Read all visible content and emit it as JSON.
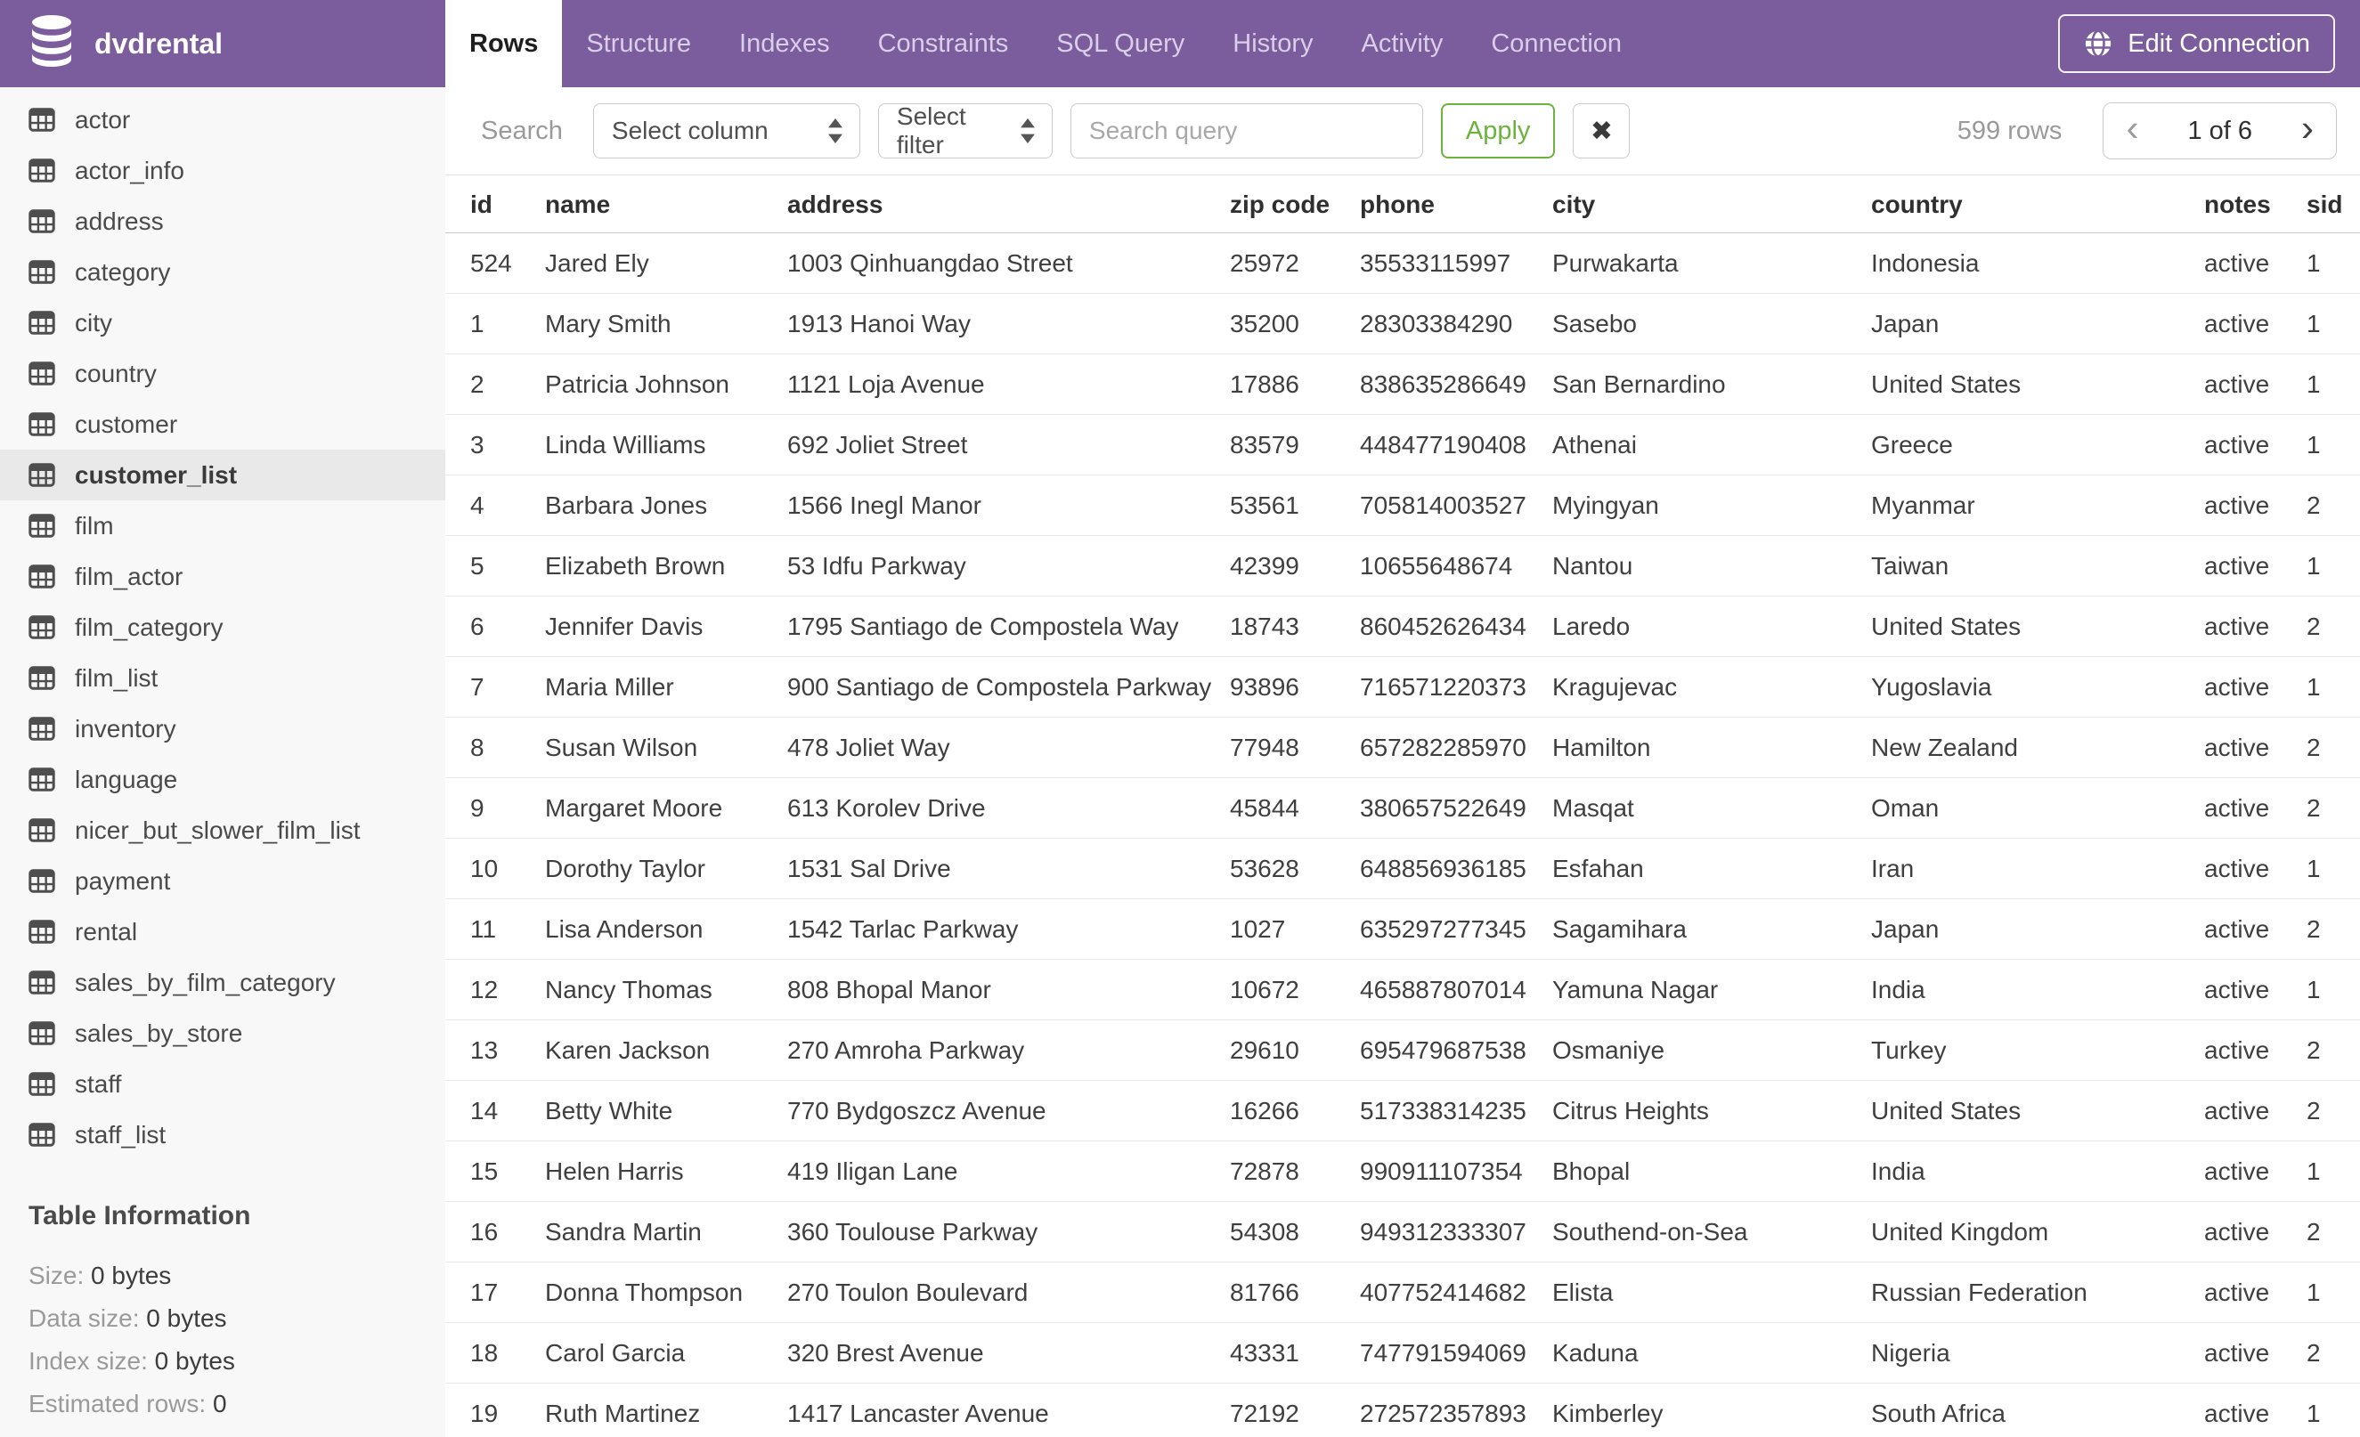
{
  "colors": {
    "header_purple": "#7b5d9d",
    "apply_green": "#6cb33e",
    "sidebar_selected": "#e9e9e9",
    "tab_inactive_text": "#d9cfe7"
  },
  "app": {
    "title": "dvdrental",
    "edit_connection_label": "Edit Connection"
  },
  "tabs": [
    {
      "label": "Rows",
      "active": true
    },
    {
      "label": "Structure",
      "active": false
    },
    {
      "label": "Indexes",
      "active": false
    },
    {
      "label": "Constraints",
      "active": false
    },
    {
      "label": "SQL Query",
      "active": false
    },
    {
      "label": "History",
      "active": false
    },
    {
      "label": "Activity",
      "active": false
    },
    {
      "label": "Connection",
      "active": false
    }
  ],
  "sidebar": {
    "tables": [
      "actor",
      "actor_info",
      "address",
      "category",
      "city",
      "country",
      "customer",
      "customer_list",
      "film",
      "film_actor",
      "film_category",
      "film_list",
      "inventory",
      "language",
      "nicer_but_slower_film_list",
      "payment",
      "rental",
      "sales_by_film_category",
      "sales_by_store",
      "staff",
      "staff_list"
    ],
    "selected": "customer_list",
    "info": {
      "heading": "Table Information",
      "rows": [
        {
          "label": "Size:",
          "value": "0 bytes"
        },
        {
          "label": "Data size:",
          "value": "0 bytes"
        },
        {
          "label": "Index size:",
          "value": "0 bytes"
        },
        {
          "label": "Estimated rows:",
          "value": "0"
        }
      ]
    }
  },
  "toolbar": {
    "search_label": "Search",
    "column_select_label": "Select column",
    "filter_select_label": "Select filter",
    "query_placeholder": "Search query",
    "apply_label": "Apply",
    "clear_label": "✖",
    "rows_count": "599 rows",
    "pagination": {
      "prev_label": "‹",
      "page_label": "1 of 6",
      "next_label": "›"
    }
  },
  "table": {
    "columns": [
      "id",
      "name",
      "address",
      "zip code",
      "phone",
      "city",
      "country",
      "notes",
      "sid"
    ],
    "rows": [
      [
        "524",
        "Jared Ely",
        "1003 Qinhuangdao Street",
        "25972",
        "35533115997",
        "Purwakarta",
        "Indonesia",
        "active",
        "1"
      ],
      [
        "1",
        "Mary Smith",
        "1913 Hanoi Way",
        "35200",
        "28303384290",
        "Sasebo",
        "Japan",
        "active",
        "1"
      ],
      [
        "2",
        "Patricia Johnson",
        "1121 Loja Avenue",
        "17886",
        "838635286649",
        "San Bernardino",
        "United States",
        "active",
        "1"
      ],
      [
        "3",
        "Linda Williams",
        "692 Joliet Street",
        "83579",
        "448477190408",
        "Athenai",
        "Greece",
        "active",
        "1"
      ],
      [
        "4",
        "Barbara Jones",
        "1566 Inegl Manor",
        "53561",
        "705814003527",
        "Myingyan",
        "Myanmar",
        "active",
        "2"
      ],
      [
        "5",
        "Elizabeth Brown",
        "53 Idfu Parkway",
        "42399",
        "10655648674",
        "Nantou",
        "Taiwan",
        "active",
        "1"
      ],
      [
        "6",
        "Jennifer Davis",
        "1795 Santiago de Compostela Way",
        "18743",
        "860452626434",
        "Laredo",
        "United States",
        "active",
        "2"
      ],
      [
        "7",
        "Maria Miller",
        "900 Santiago de Compostela Parkway",
        "93896",
        "716571220373",
        "Kragujevac",
        "Yugoslavia",
        "active",
        "1"
      ],
      [
        "8",
        "Susan Wilson",
        "478 Joliet Way",
        "77948",
        "657282285970",
        "Hamilton",
        "New Zealand",
        "active",
        "2"
      ],
      [
        "9",
        "Margaret Moore",
        "613 Korolev Drive",
        "45844",
        "380657522649",
        "Masqat",
        "Oman",
        "active",
        "2"
      ],
      [
        "10",
        "Dorothy Taylor",
        "1531 Sal Drive",
        "53628",
        "648856936185",
        "Esfahan",
        "Iran",
        "active",
        "1"
      ],
      [
        "11",
        "Lisa Anderson",
        "1542 Tarlac Parkway",
        "1027",
        "635297277345",
        "Sagamihara",
        "Japan",
        "active",
        "2"
      ],
      [
        "12",
        "Nancy Thomas",
        "808 Bhopal Manor",
        "10672",
        "465887807014",
        "Yamuna Nagar",
        "India",
        "active",
        "1"
      ],
      [
        "13",
        "Karen Jackson",
        "270 Amroha Parkway",
        "29610",
        "695479687538",
        "Osmaniye",
        "Turkey",
        "active",
        "2"
      ],
      [
        "14",
        "Betty White",
        "770 Bydgoszcz Avenue",
        "16266",
        "517338314235",
        "Citrus Heights",
        "United States",
        "active",
        "2"
      ],
      [
        "15",
        "Helen Harris",
        "419 Iligan Lane",
        "72878",
        "990911107354",
        "Bhopal",
        "India",
        "active",
        "1"
      ],
      [
        "16",
        "Sandra Martin",
        "360 Toulouse Parkway",
        "54308",
        "949312333307",
        "Southend-on-Sea",
        "United Kingdom",
        "active",
        "2"
      ],
      [
        "17",
        "Donna Thompson",
        "270 Toulon Boulevard",
        "81766",
        "407752414682",
        "Elista",
        "Russian Federation",
        "active",
        "1"
      ],
      [
        "18",
        "Carol Garcia",
        "320 Brest Avenue",
        "43331",
        "747791594069",
        "Kaduna",
        "Nigeria",
        "active",
        "2"
      ],
      [
        "19",
        "Ruth Martinez",
        "1417 Lancaster Avenue",
        "72192",
        "272572357893",
        "Kimberley",
        "South Africa",
        "active",
        "1"
      ]
    ]
  }
}
